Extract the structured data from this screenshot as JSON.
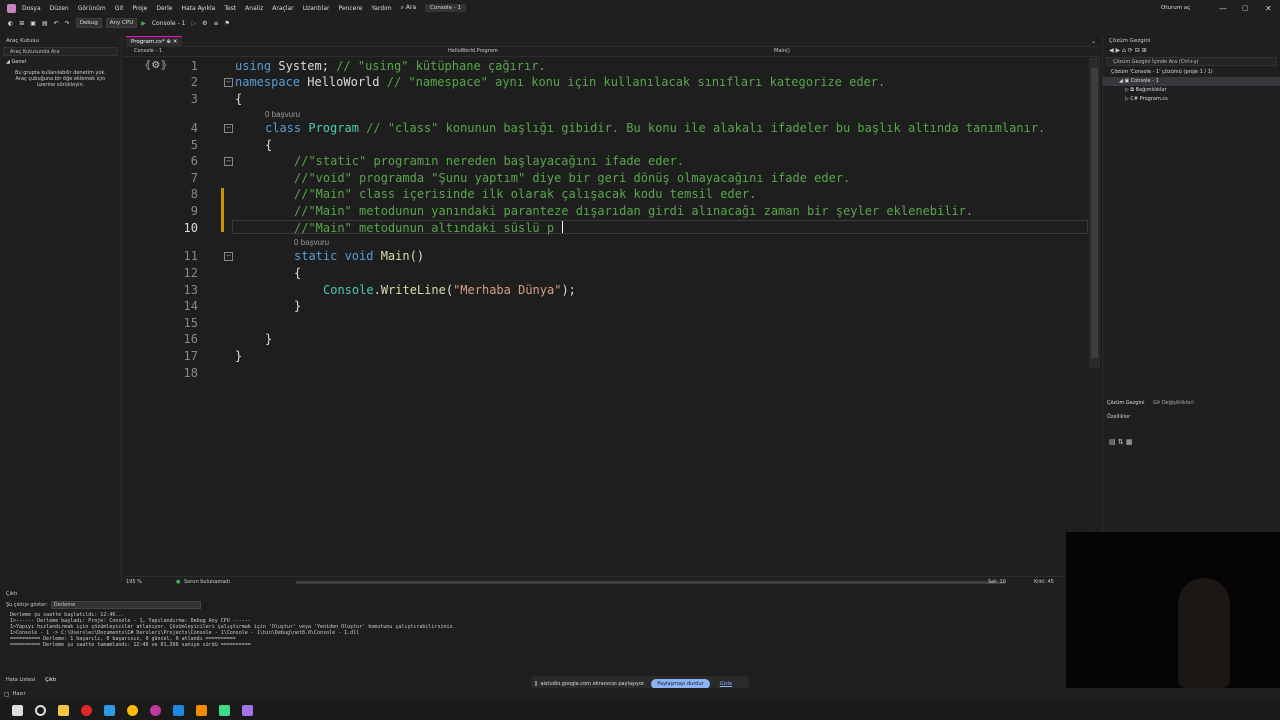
{
  "menu": {
    "items": [
      "Dosya",
      "Düzen",
      "Görünüm",
      "Git",
      "Proje",
      "Derle",
      "Hata Ayıkla",
      "Test",
      "Analiz",
      "Araçlar",
      "Uzantılar",
      "Pencere",
      "Yardım"
    ],
    "search": "Ara",
    "solution_badge": "Console - 1",
    "signin": "Oturum aç"
  },
  "toolbar": {
    "config": "Debug",
    "platform": "Any CPU",
    "run": "Console - 1"
  },
  "left": {
    "title": "Araç Kutusu",
    "search": "Araç Kutusunda Ara",
    "group": "Genel",
    "empty_text": "Bu grupta kullanılabilir denetim yok. Araç çubuğuna bir öğe eklemek için üzerine sürükleyin."
  },
  "editor": {
    "tab": "Program.cs*",
    "project": "Console - 1",
    "nav_class": "HelloWorld.Program",
    "nav_member": "Main()",
    "line_numbers": [
      "1",
      "2",
      "3",
      "4",
      "5",
      "6",
      "7",
      "8",
      "9",
      "10",
      "11",
      "12",
      "13",
      "14",
      "15",
      "16",
      "17",
      "18"
    ],
    "code": {
      "l1a": "using ",
      "l1b": "System",
      "l1c": "; ",
      "l1d": "// \"using\" kütüphane çağırır.",
      "l2a": "namespace ",
      "l2b": "HelloWorld",
      "l2c": " // \"namespace\" aynı konu için kullanılacak sınıfları kategorize eder.",
      "l3": "{",
      "l4a": "class ",
      "l4b": "Program",
      "l4c": " // \"class\" konunun başlığı gibidir. Bu konu ile alakalı ifadeler bu başlık altında tanımlanır.",
      "l5": "{",
      "l6": "//\"static\" programın nereden başlayacağını ifade eder.",
      "l7": "//\"void\" programda \"Şunu yaptım\" diye bir geri dönüş olmayacağını ifade eder.",
      "l8": "//\"Main\" class içerisinde ilk olarak çalışacak kodu temsil eder.",
      "l9": "//\"Main\" metodunun yanındaki paranteze dışarıdan girdi alınacağı zaman bir şeyler eklenebilir.",
      "l10": "//\"Main\" metodunun altındaki süslü p",
      "l11a": "static void ",
      "l11b": "Main",
      "l11c": "()",
      "l12": "{",
      "l13a": "Console",
      "l13b": ".",
      "l13c": "WriteLine",
      "l13d": "(",
      "l13e": "\"Merhaba Dünya\"",
      "l13f": ");",
      "l14": "}",
      "l16": "}",
      "l17": "}"
    },
    "refs_class": "0 başvuru",
    "refs_main": "0 başvuru"
  },
  "status": {
    "zoom": "195 %",
    "issues": "Sorun bulunamadı",
    "line": "Sat: 10",
    "col": "Krkt: 45"
  },
  "right": {
    "title": "Çözüm Gezgini",
    "search": "Çözüm Gezgini İçinde Ara (Ctrl+ş)",
    "solution": "Çözüm 'Console - 1' çözümü (proje 1 / 1)",
    "project": "Console - 1",
    "deps": "Bağımlılıklar",
    "file": "Program.cs",
    "tab1": "Çözüm Gezgini",
    "tab2": "Git Değişiklikleri",
    "props": "Özellikler"
  },
  "output": {
    "title": "Çıktı",
    "source_label": "Şu çıktıyı göster:",
    "source": "Derleme",
    "lines": [
      "Derleme şu saatte başlatıldı: 12:46...",
      "1>------ Derleme başladı: Proje: Console - 1, Yapılandırma: Debug Any CPU ------",
      "1>Yapıyı hızlandırmak için çözümleyiciler atlanıyor. Çözümleyicileri çalıştırmak için 'Oluştur' veya 'Yeniden Oluştur' komutunu çalıştırabilirsiniz.",
      "1>Console - 1 -> C:\\Users\\ec\\Documents\\C# Dersleri\\Projects\\Console - 1\\Console - 1\\bin\\Debug\\net8.0\\Console - 1.dll",
      "========== Derleme: 1 başarılı, 0 başarısız, 0 güncel, 0 atlandı ==========",
      "========== Derleme şu saatte tamamlandı: 12:46 ve 01,396 saniye sürdü =========="
    ],
    "tab_errors": "Hata Listesi",
    "tab_output": "Çıktı"
  },
  "share": {
    "text": "aistudio.google.com ekranınızı paylaşıyor.",
    "stop": "Paylaşmayı durdur",
    "hide": "Gizle"
  },
  "statusbar": {
    "ready": "Hazır"
  }
}
